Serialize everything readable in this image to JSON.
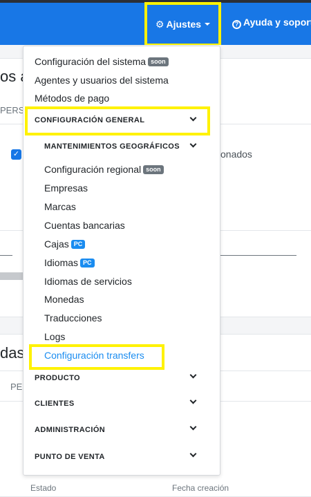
{
  "navbar": {
    "ajustes_label": "Ajustes",
    "ayuda_label": "Ayuda y soport"
  },
  "background": {
    "heading_1": "os a",
    "tab_1": "PERSO",
    "checkbox_text": "onados",
    "heading_2": "das",
    "tab_2": "PE",
    "col_estado": "Estado",
    "col_fecha": "Fecha creación"
  },
  "dropdown": {
    "items_top": [
      {
        "label": "Configuración del sistema",
        "badge": "soon"
      },
      {
        "label": "Agentes y usuarios del sistema"
      },
      {
        "label": "Métodos de pago"
      }
    ],
    "section_general": "CONFIGURACIÓN GENERAL",
    "subsection_geo": "MANTENIMIENTOS GEOGRÁFICOS",
    "geo_items": [
      {
        "label": "Configuración regional",
        "badge": "soon"
      },
      {
        "label": "Empresas"
      },
      {
        "label": "Marcas"
      },
      {
        "label": "Cuentas bancarias"
      },
      {
        "label": "Cajas",
        "badge": "PC"
      },
      {
        "label": "Idiomas",
        "badge": "PC"
      },
      {
        "label": "Idiomas de servicios"
      },
      {
        "label": "Monedas"
      },
      {
        "label": "Traducciones"
      },
      {
        "label": "Logs"
      },
      {
        "label": "Configuración transfers"
      }
    ],
    "sections_bottom": [
      "PRODUCTO",
      "CLIENTES",
      "ADMINISTRACIÓN",
      "PUNTO DE VENTA"
    ]
  },
  "colors": {
    "navbar": "#1877e6",
    "highlight": "#fff200",
    "active_link": "#1a8cf0",
    "badge_soon": "#6c757d",
    "badge_pc": "#1a8cf0"
  }
}
